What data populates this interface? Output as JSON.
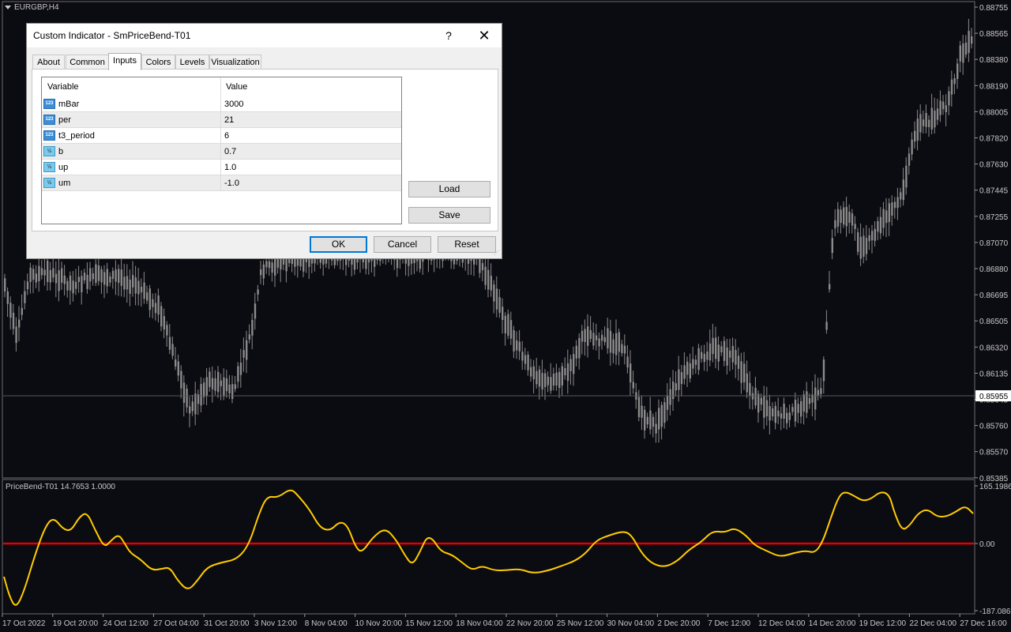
{
  "chart": {
    "symbol_label": "EURGBP,H4",
    "price_ticks": [
      "0.88755",
      "0.88565",
      "0.88380",
      "0.88190",
      "0.88005",
      "0.87820",
      "0.87630",
      "0.87445",
      "0.87255",
      "0.87070",
      "0.86880",
      "0.86695",
      "0.86505",
      "0.86320",
      "0.86135",
      "0.85945",
      "0.85760",
      "0.85570",
      "0.85385"
    ],
    "current_price": "0.85955",
    "indicator_label": "PriceBend-T01 14.7653 1.0000",
    "indicator_ticks": [
      "165.1986",
      "0.00",
      "-187.0861"
    ],
    "time_labels": [
      "17 Oct 2022",
      "19 Oct 20:00",
      "24 Oct 12:00",
      "27 Oct 04:00",
      "31 Oct 20:00",
      "3 Nov 12:00",
      "8 Nov 04:00",
      "10 Nov 20:00",
      "15 Nov 12:00",
      "18 Nov 04:00",
      "22 Nov 20:00",
      "25 Nov 12:00",
      "30 Nov 04:00",
      "2 Dec 20:00",
      "7 Dec 12:00",
      "12 Dec 04:00",
      "14 Dec 20:00",
      "19 Dec 12:00",
      "22 Dec 04:00",
      "27 Dec 16:00"
    ],
    "colors": {
      "background": "#0b0b12",
      "candle": "#8c8c8c",
      "indicator_line": "#ffcc00",
      "zero_line": "#e00000",
      "current_price_line": "#5a5a5a"
    }
  },
  "dialog": {
    "title": "Custom Indicator - SmPriceBend-T01",
    "help": "?",
    "close": "✕",
    "tabs": [
      "About",
      "Common",
      "Inputs",
      "Colors",
      "Levels",
      "Visualization"
    ],
    "active_tab": "Inputs",
    "columns": [
      "Variable",
      "Value"
    ],
    "rows": [
      {
        "icon": "int-icon",
        "name": "mBar",
        "value": "3000"
      },
      {
        "icon": "int-icon",
        "name": "per",
        "value": "21"
      },
      {
        "icon": "int-icon",
        "name": "t3_period",
        "value": "6"
      },
      {
        "icon": "double-icon",
        "name": "b",
        "value": "0.7"
      },
      {
        "icon": "double-icon",
        "name": "up",
        "value": "1.0"
      },
      {
        "icon": "double-icon",
        "name": "um",
        "value": "-1.0"
      }
    ],
    "buttons": {
      "load": "Load",
      "save": "Save",
      "ok": "OK",
      "cancel": "Cancel",
      "reset": "Reset"
    }
  }
}
